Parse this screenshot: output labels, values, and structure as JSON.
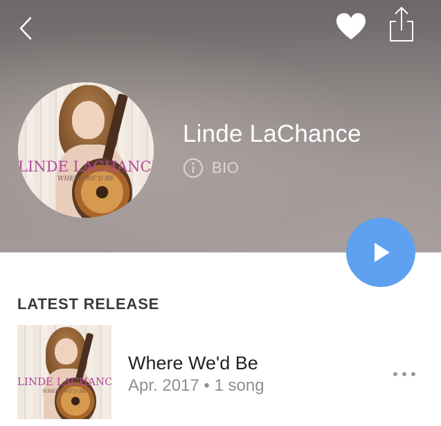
{
  "header": {
    "artist_name": "Linde LaChance",
    "bio_label": "BIO"
  },
  "album_art": {
    "title": "LINDE LACHANCE",
    "subtitle": "WHERE WE'D BE"
  },
  "latest_release": {
    "heading": "LATEST RELEASE",
    "title": "Where We'd Be",
    "meta": "Apr. 2017 • 1 song"
  },
  "icons": {
    "back": "chevron-left-icon",
    "favorite": "heart-icon",
    "share": "share-icon",
    "info": "info-icon",
    "play": "play-icon",
    "more": "more-dots-icon"
  },
  "colors": {
    "play_button": "#5da1f0",
    "header_text": "#ffffff",
    "album_title": "#b04a9c"
  }
}
